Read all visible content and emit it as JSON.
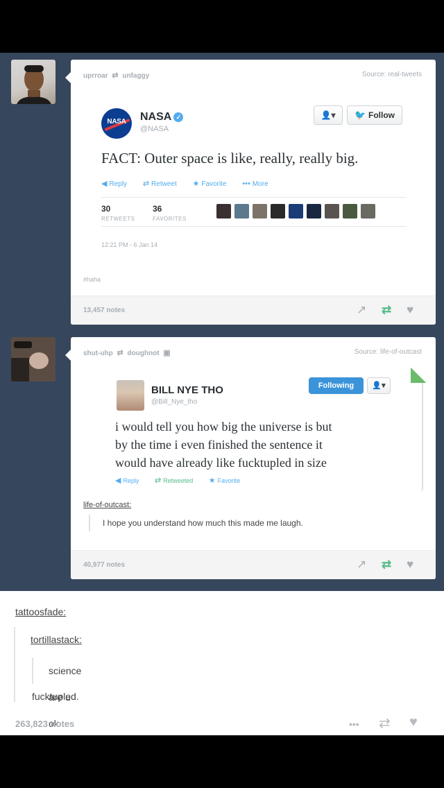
{
  "post1": {
    "reblog_from": "uprroar",
    "reblog_to": "unfaggy",
    "source": "Source: real-tweets",
    "tweet": {
      "name": "NASA",
      "handle": "@NASA",
      "logo_text": "NASA",
      "follow_label": "Follow",
      "person_label": "👤▾",
      "text": "FACT: Outer space is like, really, really big.",
      "actions": {
        "reply": "Reply",
        "retweet": "Retweet",
        "favorite": "Favorite",
        "more": "More"
      },
      "retweets": "30",
      "retweets_label": "RETWEETS",
      "favorites": "36",
      "favorites_label": "FAVORITES",
      "timestamp": "12:21 PM - 6 Jan 14"
    },
    "tag": "#haha",
    "notes": "13,457 notes"
  },
  "post2": {
    "reblog_from": "shut-uhp",
    "reblog_to": "doughnot",
    "source": "Source: life-of-outcast",
    "tweet": {
      "name": "BILL NYE THO",
      "handle": "@Bill_Nye_tho",
      "following_label": "Following",
      "person_label": "👤▾",
      "text_lines": [
        "i would tell you how big the universe is but",
        "by the time i even finished the sentence it",
        "would have already like fucktupled in size"
      ],
      "actions": {
        "reply": "Reply",
        "retweet": "Retweeted",
        "favorite": "Favorite"
      }
    },
    "quote_author": "life-of-outcast:",
    "quote_text": "I hope you understand how much this made me laugh.",
    "notes": "40,977 notes"
  },
  "post3": {
    "user1": "tattoosfade:",
    "user2": "tortillastack:",
    "quote": "science are u ok",
    "reply": "fucktupled.",
    "notes": "263,823 notes",
    "more_icon": "•••"
  },
  "colors": {
    "dashboard": "#36465d",
    "twitter_blue": "#55acee",
    "reblog_green": "#56bc8a"
  }
}
